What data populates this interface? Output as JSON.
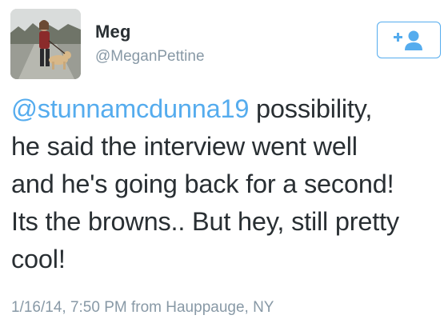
{
  "author": {
    "name": "Meg",
    "handle": "@MeganPettine"
  },
  "follow_button": {
    "icon": "follow-user-icon",
    "color": "#55acee"
  },
  "tweet": {
    "mention": "@stunnamcdunna19",
    "text": " possibility,\nhe said the interview went well\nand he's going back for a second!\nIts the browns.. But hey, still pretty\ncool!"
  },
  "meta": {
    "timestamp_location": "1/16/14, 7:50 PM from Hauppauge, NY"
  },
  "colors": {
    "link": "#55acee",
    "text": "#292f33",
    "secondary": "#8899a6"
  }
}
